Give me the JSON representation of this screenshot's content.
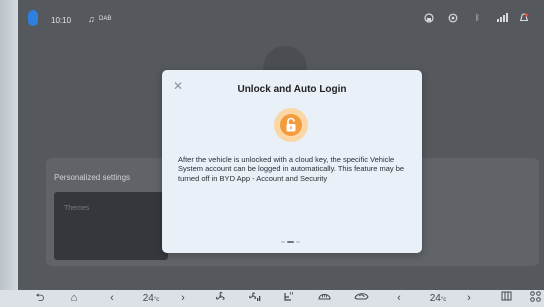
{
  "statusbar": {
    "time": "10:10",
    "music_icon": "music-note-icon",
    "music_label": "DAB",
    "icons": [
      "headset-icon",
      "location-icon",
      "bluetooth-icon",
      "signal-icon",
      "notification-icon"
    ]
  },
  "background": {
    "panel_title": "Personalized settings",
    "theme_label": "Themes"
  },
  "dialog": {
    "close_symbol": "✕",
    "title": "Unlock and Auto Login",
    "icon": "unlock-icon",
    "body": "After the vehicle is unlocked with a cloud key, the specific Vehicle System account can be logged in automatically. This feature may be turned off in BYD App - Account and Security",
    "pager": {
      "pages": 3,
      "current": 2
    }
  },
  "navbar": {
    "back": "⮌",
    "home": "⌂",
    "left_temp_value": "24",
    "left_temp_unit": "°c",
    "right_temp_value": "24",
    "right_temp_unit": "°c",
    "left_arrow": "‹",
    "right_arrow": "›",
    "icons": [
      "back-icon",
      "home-icon",
      "fan-icon",
      "fan-speed-icon",
      "seat-heat-icon",
      "front-defrost-icon",
      "recirculation-icon",
      "media-icon",
      "apps-icon"
    ]
  },
  "colors": {
    "accent_orange": "#f49c3d",
    "dialog_bg": "#eaf0f8",
    "screen_bg": "#55585c"
  }
}
